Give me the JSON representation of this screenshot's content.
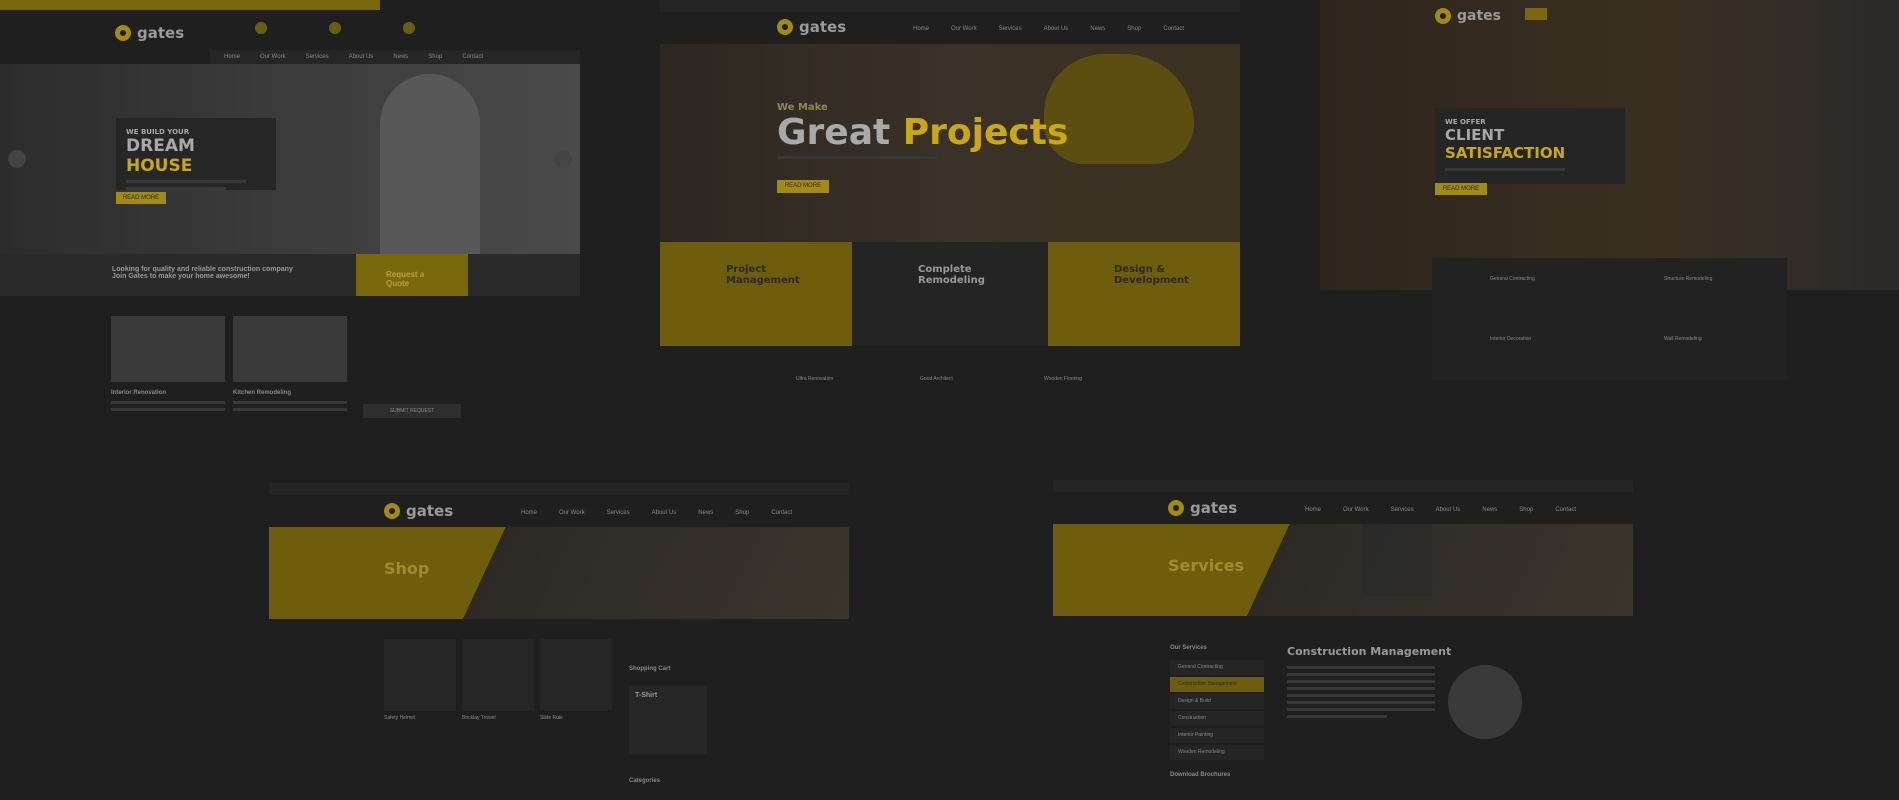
{
  "brand": {
    "name": "gates"
  },
  "colors": {
    "accent": "#a38a10",
    "bg": "#1f1f1f",
    "dark": "#262626"
  },
  "panel1": {
    "nav": [
      "Home",
      "Our Work",
      "Services",
      "About Us",
      "News",
      "Shop",
      "Contact"
    ],
    "hero_small": "WE BUILD YOUR",
    "hero_big_a": "DREAM",
    "hero_big_b": "HOUSE",
    "hero_button": "READ MORE",
    "banner_line1": "Looking for quality and reliable construction company",
    "banner_line2": "Join Gates to make your home awesome!",
    "quote_button": "Request a Quote",
    "cards": [
      "Interior Renovation",
      "Kitchen Remodeling"
    ],
    "submit": "SUBMIT REQUEST"
  },
  "panel2": {
    "nav": [
      "Home",
      "Our Work",
      "Services",
      "About Us",
      "News",
      "Shop",
      "Contact"
    ],
    "hero_small": "We Make",
    "hero_big_a": "Great",
    "hero_big_b": "Projects",
    "hero_button": "READ MORE",
    "features": [
      {
        "title_a": "Project",
        "title_b": "Management"
      },
      {
        "title_a": "Complete",
        "title_b": "Remodeling"
      },
      {
        "title_a": "Design &",
        "title_b": "Development"
      }
    ],
    "services": [
      "Ultra Renovation",
      "Good Architect",
      "Wooden Flooring"
    ]
  },
  "panel3": {
    "hero_small": "WE OFFER",
    "hero_big_a": "CLIENT",
    "hero_big_b": "SATISFACTION",
    "hero_button": "READ MORE",
    "services": [
      "General Contracting",
      "Structure Remodeling",
      "Interior Decoration",
      "Wall Remodeling"
    ]
  },
  "panel4": {
    "nav": [
      "Home",
      "Our Work",
      "Services",
      "About Us",
      "News",
      "Shop",
      "Contact"
    ],
    "title": "Shop",
    "products": [
      "Safety Helmet",
      "Bricklay Trowel",
      "Slide Rule"
    ],
    "cart_title": "Shopping Cart",
    "cart_item": "T-Shirt",
    "categories": "Categories"
  },
  "panel5": {
    "nav": [
      "Home",
      "Our Work",
      "Services",
      "About Us",
      "News",
      "Shop",
      "Contact"
    ],
    "title": "Services",
    "sidebar_title": "Our Services",
    "sidebar": [
      "General Contracting",
      "Construction Management",
      "Design & Build",
      "Construction",
      "Interior Painting",
      "Wooden Remodeling"
    ],
    "downloads": "Download Brochures",
    "heading": "Construction Management"
  }
}
